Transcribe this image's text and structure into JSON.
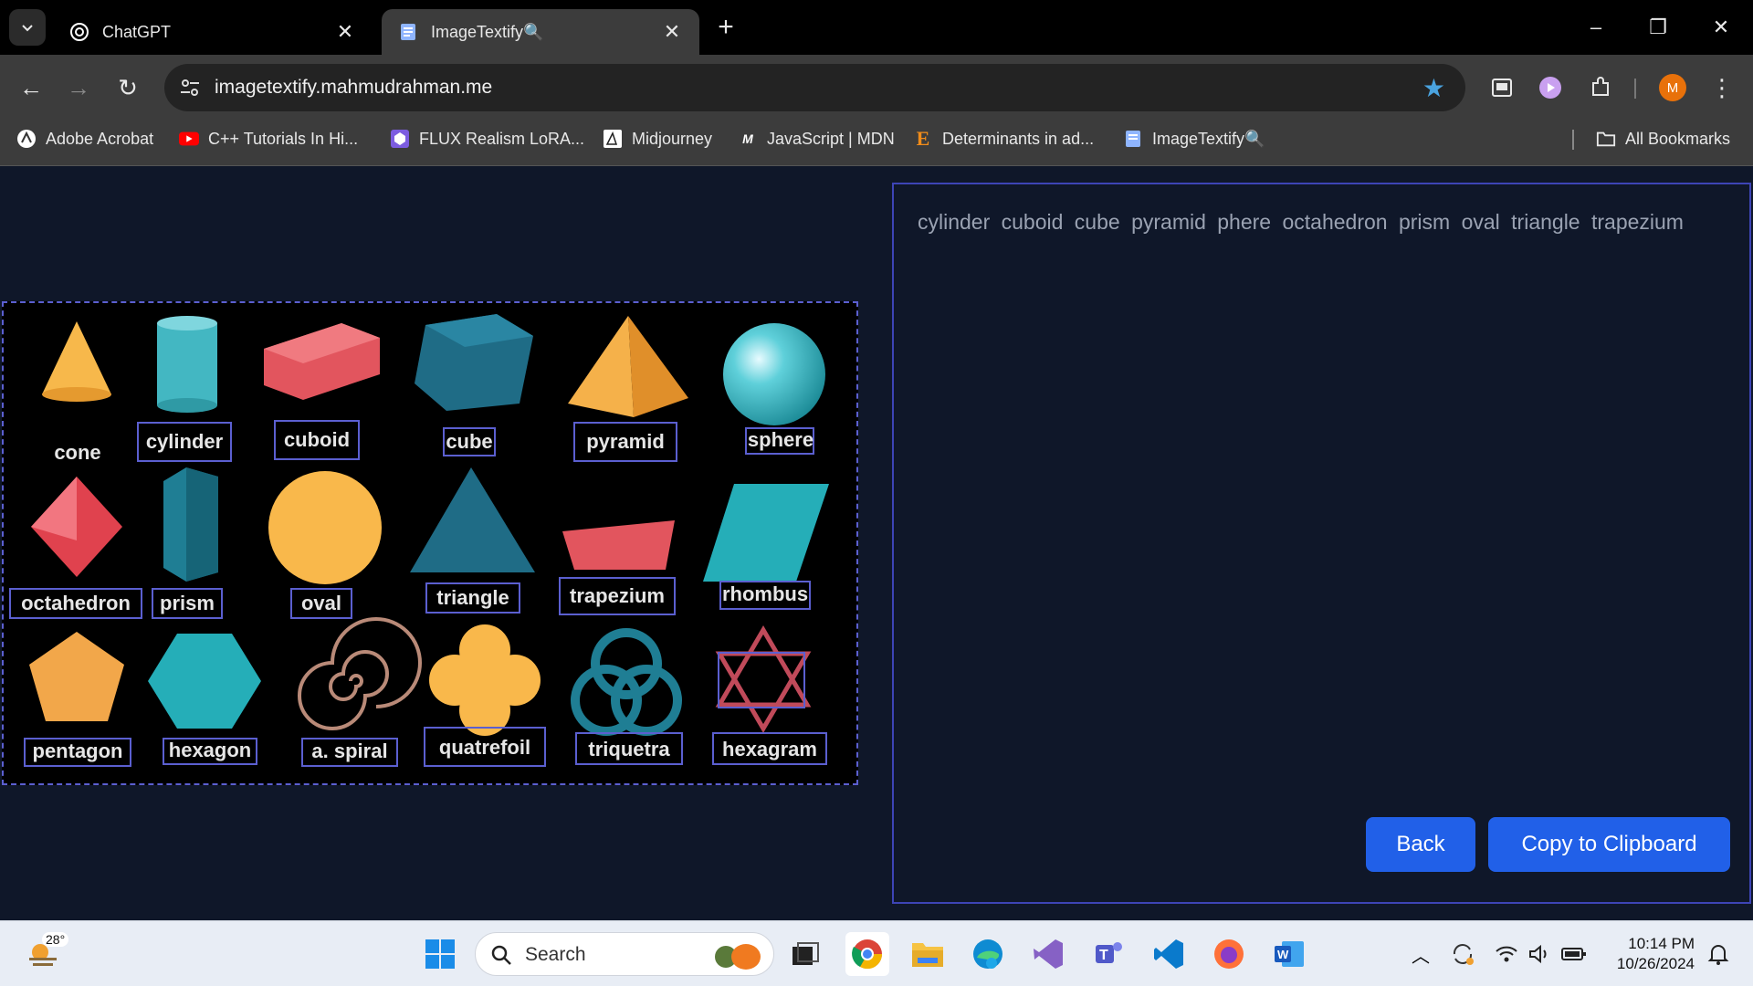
{
  "browser": {
    "tabs": [
      {
        "title": "ChatGPT",
        "active": false
      },
      {
        "title": "ImageTextify🔍",
        "active": true
      }
    ],
    "url": "imagetextify.mahmudrahman.me",
    "bookmarks": [
      {
        "label": "Adobe Acrobat"
      },
      {
        "label": "C++ Tutorials In Hi..."
      },
      {
        "label": "FLUX Realism LoRA..."
      },
      {
        "label": "Midjourney"
      },
      {
        "label": "JavaScript | MDN"
      },
      {
        "label": "Determinants in ad..."
      },
      {
        "label": "ImageTextify🔍"
      }
    ],
    "all_bookmarks_label": "All Bookmarks",
    "profile_initial": "M",
    "accent_color": "#4aa3df"
  },
  "image": {
    "shape_labels": [
      "cone",
      "cylinder",
      "cuboid",
      "cube",
      "pyramid",
      "sphere",
      "octahedron",
      "prism",
      "oval",
      "triangle",
      "trapezium",
      "rhombus",
      "pentagon",
      "hexagon",
      "a. spiral",
      "quatrefoil",
      "triquetra",
      "hexagram"
    ],
    "box_color": "#5b5fd0"
  },
  "result": {
    "extracted_text": "cylinder cuboid cube pyramid phere octahedron prism oval triangle trapezium",
    "back_label": "Back",
    "copy_label": "Copy to Clipboard",
    "button_color": "#2160e8"
  },
  "taskbar": {
    "weather_temp": "28°",
    "search_placeholder": "Search",
    "time": "10:14 PM",
    "date": "10/26/2024"
  }
}
